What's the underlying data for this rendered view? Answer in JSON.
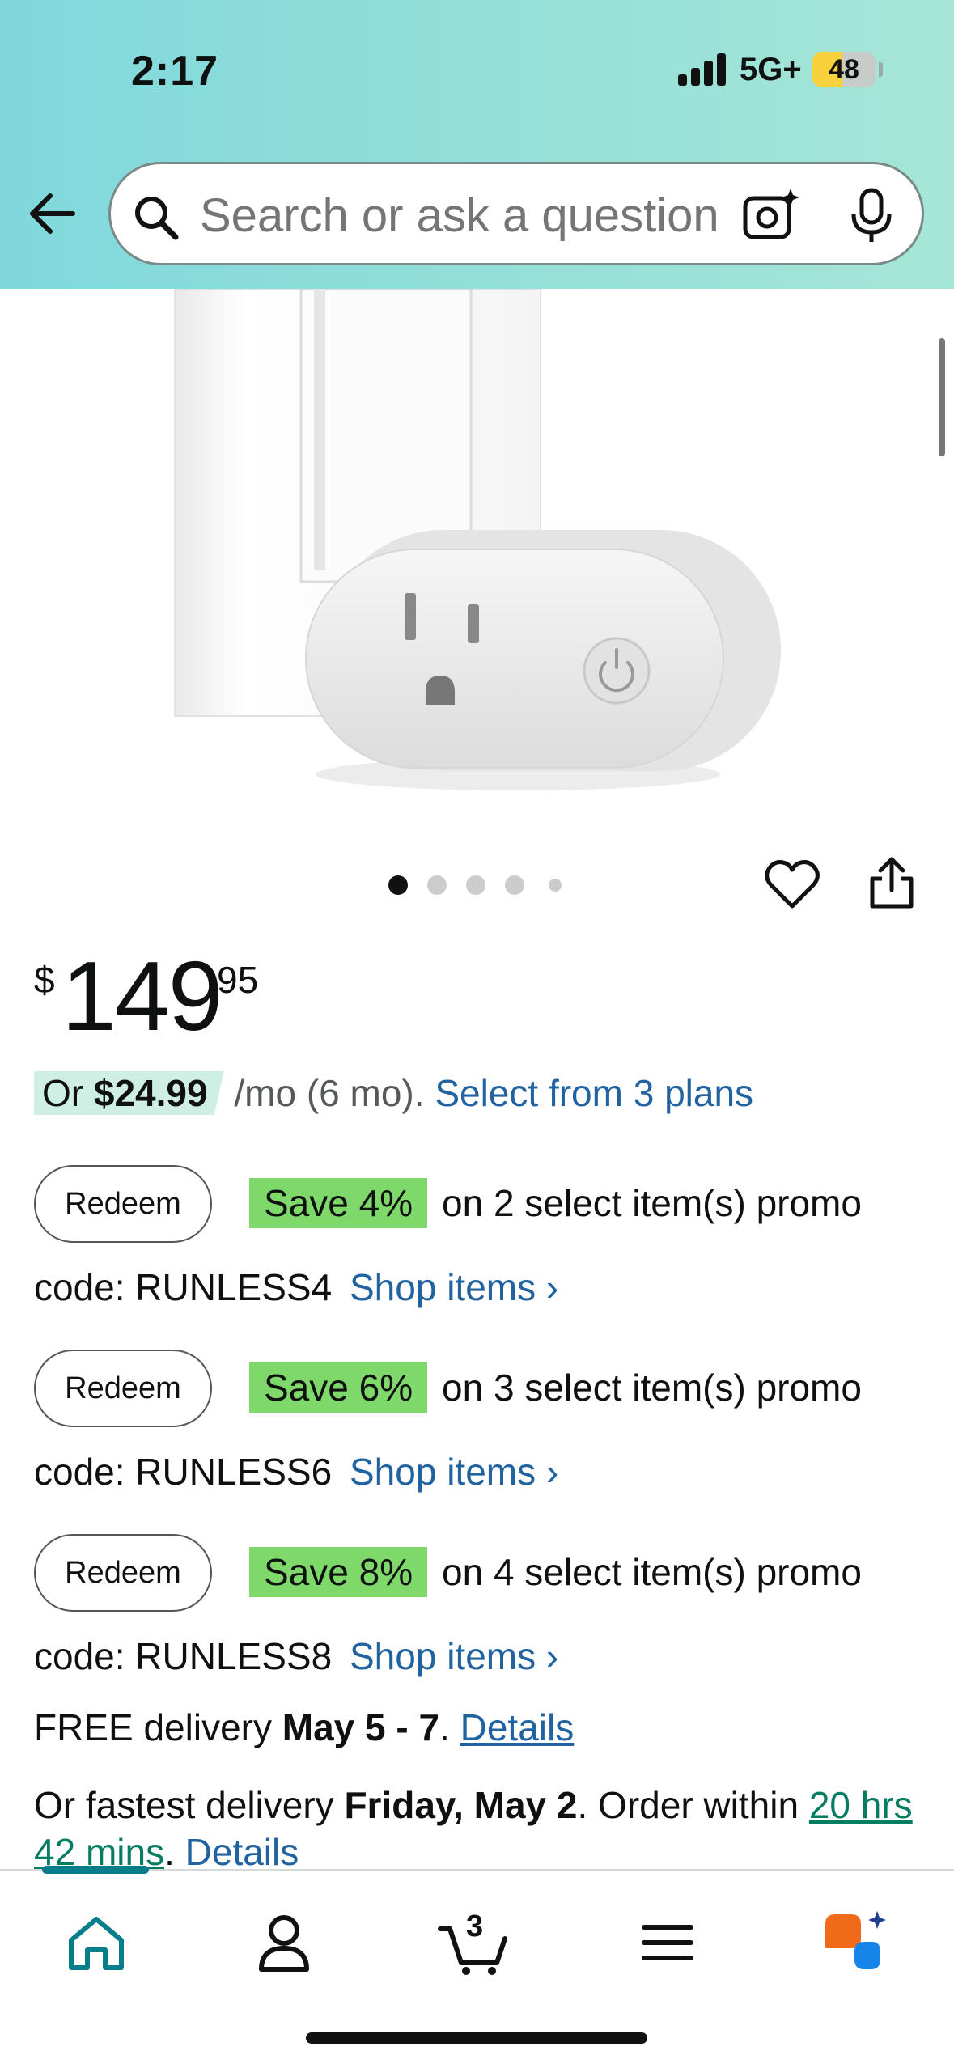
{
  "status_bar": {
    "time": "2:17",
    "network": "5G+",
    "battery": "48"
  },
  "header": {
    "search_placeholder": "Search or ask a question"
  },
  "gallery": {
    "dot_count": 5,
    "active_index": 0
  },
  "price": {
    "symbol": "$",
    "whole": "149",
    "fraction": "95"
  },
  "financing": {
    "prefix": "Or ",
    "amount": "$24.99",
    "suffix": " /mo (6 mo). ",
    "link": "Select from 3 plans"
  },
  "promos": [
    {
      "button": "Redeem",
      "badge": "Save 4%",
      "text": "on 2 select item(s) promo",
      "code": "code: RUNLESS4",
      "link": "Shop items ›"
    },
    {
      "button": "Redeem",
      "badge": "Save 6%",
      "text": "on 3 select item(s) promo",
      "code": "code: RUNLESS6",
      "link": "Shop items ›"
    },
    {
      "button": "Redeem",
      "badge": "Save 8%",
      "text": "on 4 select item(s) promo",
      "code": "code: RUNLESS8",
      "link": "Shop items ›"
    }
  ],
  "delivery": {
    "prefix": "FREE delivery ",
    "dates": "May 5 - 7",
    "sep": ". ",
    "link": "Details"
  },
  "fastest": {
    "prefix": "Or fastest delivery ",
    "date": "Friday, May 2",
    "mid": ". Order within ",
    "countdown": "20 hrs 42 mins",
    "sep": ". ",
    "link": "Details"
  },
  "bottom_nav": {
    "cart_count": "3"
  },
  "colors": {
    "accent": "#067d8a",
    "link": "#2162a1",
    "save_badge": "#7ed96a",
    "countdown": "#067d62"
  }
}
